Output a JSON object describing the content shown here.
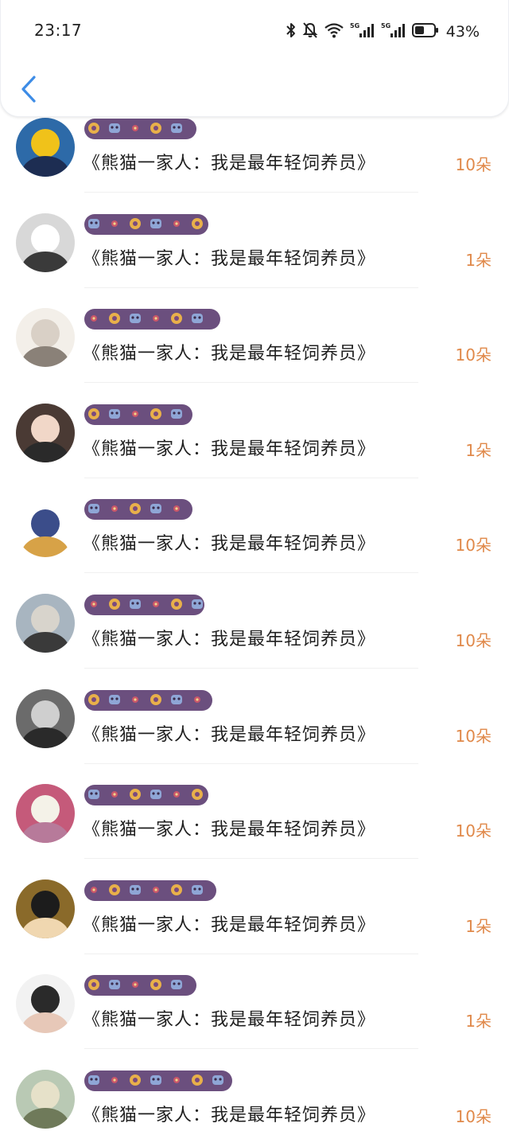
{
  "status_bar": {
    "time": "23:17",
    "battery_percent": "43%",
    "icons": [
      "bluetooth-icon",
      "mute-bell-icon",
      "wifi-icon",
      "5g-signal-icon",
      "5g-signal-icon",
      "battery-icon"
    ]
  },
  "header": {
    "back_icon": "chevron-left-icon",
    "accent": "#3d8ce6"
  },
  "colors": {
    "count": "#e0894a",
    "name_mask": "#6b4f7e"
  },
  "rows": [
    {
      "title": "《熊猫一家人：我是最年轻饲养员》",
      "count": "10朵"
    },
    {
      "title": "《熊猫一家人：我是最年轻饲养员》",
      "count": "1朵"
    },
    {
      "title": "《熊猫一家人：我是最年轻饲养员》",
      "count": "10朵"
    },
    {
      "title": "《熊猫一家人：我是最年轻饲养员》",
      "count": "1朵"
    },
    {
      "title": "《熊猫一家人：我是最年轻饲养员》",
      "count": "10朵"
    },
    {
      "title": "《熊猫一家人：我是最年轻饲养员》",
      "count": "10朵"
    },
    {
      "title": "《熊猫一家人：我是最年轻饲养员》",
      "count": "10朵"
    },
    {
      "title": "《熊猫一家人：我是最年轻饲养员》",
      "count": "10朵"
    },
    {
      "title": "《熊猫一家人：我是最年轻饲养员》",
      "count": "1朵"
    },
    {
      "title": "《熊猫一家人：我是最年轻饲养员》",
      "count": "1朵"
    },
    {
      "title": "《熊猫一家人：我是最年轻饲养员》",
      "count": "10朵"
    }
  ]
}
